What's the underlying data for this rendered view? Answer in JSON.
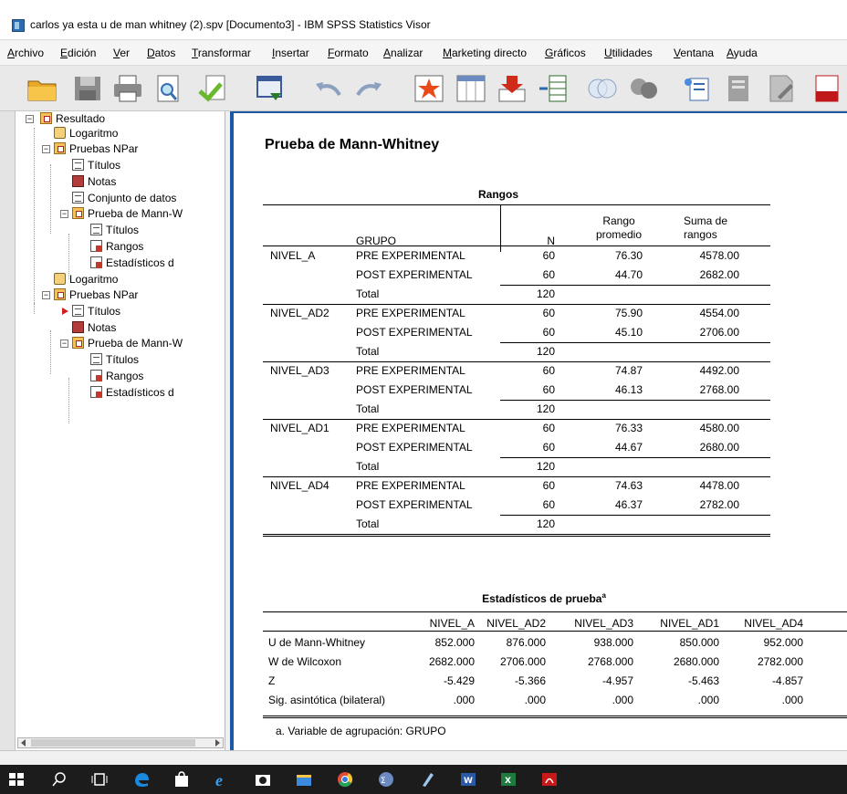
{
  "window": {
    "title": "carlos ya esta u de man whitney (2).spv [Documento3] - IBM SPSS Statistics Visor"
  },
  "menu": [
    "Archivo",
    "Edición",
    "Ver",
    "Datos",
    "Transformar",
    "Insertar",
    "Formato",
    "Analizar",
    "Marketing directo",
    "Gráficos",
    "Utilidades",
    "Ventana",
    "Ayuda"
  ],
  "toolbar": [
    "open-folder-icon",
    "save-icon",
    "print-icon",
    "print-preview-icon",
    "export-icon",
    "recall-dialog-icon",
    "undo-icon",
    "redo-icon",
    "goto-data-icon",
    "goto-case-icon",
    "goto-variable-icon",
    "variables-icon",
    "venn-icon",
    "circles-icon",
    "spelling-icon",
    "designate-icon",
    "insert-output-icon",
    "pdf-icon"
  ],
  "outline": {
    "root": "Resultado",
    "items": [
      {
        "label": "Logaritmo"
      },
      {
        "label": "Pruebas NPar"
      },
      {
        "label": "Títulos"
      },
      {
        "label": "Notas"
      },
      {
        "label": "Conjunto de datos"
      },
      {
        "label": "Prueba de Mann-W"
      },
      {
        "label": "Títulos"
      },
      {
        "label": "Rangos"
      },
      {
        "label": "Estadísticos d"
      },
      {
        "label": "Logaritmo"
      },
      {
        "label": "Pruebas NPar"
      },
      {
        "label": "Títulos"
      },
      {
        "label": "Notas"
      },
      {
        "label": "Prueba de Mann-W"
      },
      {
        "label": "Títulos"
      },
      {
        "label": "Rangos"
      },
      {
        "label": "Estadísticos d"
      }
    ]
  },
  "output": {
    "page_title": "Prueba de Mann-Whitney",
    "ranks": {
      "caption": "Rangos",
      "headers": {
        "grupo": "GRUPO",
        "n": "N",
        "rango1": "Rango",
        "rango2": "promedio",
        "suma1": "Suma de",
        "suma2": "rangos"
      },
      "rows": [
        {
          "var": "NIVEL_A",
          "group": "PRE EXPERIMENTAL",
          "n": "60",
          "mean": "76.30",
          "sum": "4578.00"
        },
        {
          "var": "",
          "group": "POST EXPERIMENTAL",
          "n": "60",
          "mean": "44.70",
          "sum": "2682.00"
        },
        {
          "var": "",
          "group": "Total",
          "n": "120",
          "mean": "",
          "sum": ""
        },
        {
          "var": "NIVEL_AD2",
          "group": "PRE EXPERIMENTAL",
          "n": "60",
          "mean": "75.90",
          "sum": "4554.00"
        },
        {
          "var": "",
          "group": "POST EXPERIMENTAL",
          "n": "60",
          "mean": "45.10",
          "sum": "2706.00"
        },
        {
          "var": "",
          "group": "Total",
          "n": "120",
          "mean": "",
          "sum": ""
        },
        {
          "var": "NIVEL_AD3",
          "group": "PRE EXPERIMENTAL",
          "n": "60",
          "mean": "74.87",
          "sum": "4492.00"
        },
        {
          "var": "",
          "group": "POST EXPERIMENTAL",
          "n": "60",
          "mean": "46.13",
          "sum": "2768.00"
        },
        {
          "var": "",
          "group": "Total",
          "n": "120",
          "mean": "",
          "sum": ""
        },
        {
          "var": "NIVEL_AD1",
          "group": "PRE EXPERIMENTAL",
          "n": "60",
          "mean": "76.33",
          "sum": "4580.00"
        },
        {
          "var": "",
          "group": "POST EXPERIMENTAL",
          "n": "60",
          "mean": "44.67",
          "sum": "2680.00"
        },
        {
          "var": "",
          "group": "Total",
          "n": "120",
          "mean": "",
          "sum": ""
        },
        {
          "var": "NIVEL_AD4",
          "group": "PRE EXPERIMENTAL",
          "n": "60",
          "mean": "74.63",
          "sum": "4478.00"
        },
        {
          "var": "",
          "group": "POST EXPERIMENTAL",
          "n": "60",
          "mean": "46.37",
          "sum": "2782.00"
        },
        {
          "var": "",
          "group": "Total",
          "n": "120",
          "mean": "",
          "sum": ""
        }
      ]
    },
    "stats": {
      "caption": "Estadísticos de prueba",
      "caption_sup": "a",
      "columns": [
        "NIVEL_A",
        "NIVEL_AD2",
        "NIVEL_AD3",
        "NIVEL_AD1",
        "NIVEL_AD4"
      ],
      "rows": [
        {
          "label": "U de Mann-Whitney",
          "values": [
            "852.000",
            "876.000",
            "938.000",
            "850.000",
            "952.000"
          ]
        },
        {
          "label": "W de Wilcoxon",
          "values": [
            "2682.000",
            "2706.000",
            "2768.000",
            "2680.000",
            "2782.000"
          ]
        },
        {
          "label": "Z",
          "values": [
            "-5.429",
            "-5.366",
            "-4.957",
            "-5.463",
            "-4.857"
          ]
        },
        {
          "label": "Sig. asintótica (bilateral)",
          "values": [
            ".000",
            ".000",
            ".000",
            ".000",
            ".000"
          ]
        }
      ],
      "footnote": "a. Variable de agrupación: GRUPO"
    }
  },
  "taskbar": [
    "windows-start-icon",
    "search-icon",
    "task-view-icon",
    "edge-icon",
    "store-icon",
    "ie-icon",
    "camera-icon",
    "file-explorer-icon",
    "chrome-icon",
    "spss-icon",
    "pen-icon",
    "word-icon",
    "excel-icon",
    "acrobat-icon"
  ]
}
